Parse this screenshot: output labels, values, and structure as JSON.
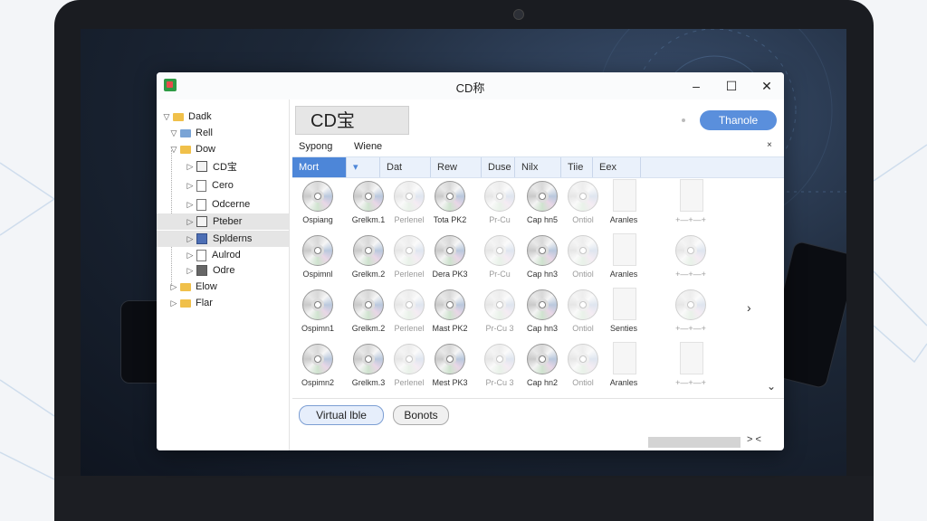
{
  "window": {
    "title": "CD称"
  },
  "controls": {
    "minimize": "–",
    "maximize": "☐",
    "close": "✕"
  },
  "sidebar": {
    "items": [
      {
        "toggle": "▽",
        "label": "Dadk"
      },
      {
        "toggle": "▽",
        "label": "Rell"
      },
      {
        "toggle": "▽",
        "label": "Dow"
      },
      {
        "toggle": "▷",
        "label": "CD宝"
      },
      {
        "toggle": "▷",
        "label": "Cero"
      },
      {
        "toggle": "▷",
        "label": "Odcerne"
      },
      {
        "toggle": "▷",
        "label": "Pteber"
      },
      {
        "toggle": "▷",
        "label": "Splderns"
      },
      {
        "toggle": "▷",
        "label": "Aulrod"
      },
      {
        "toggle": "▷",
        "label": "Odre"
      },
      {
        "toggle": "▷",
        "label": "Elow"
      },
      {
        "toggle": "▷",
        "label": "Flar"
      }
    ]
  },
  "header": {
    "title_box": "CD宝",
    "primary_button": "Thanole"
  },
  "tabs": [
    "Sypong",
    "Wiene"
  ],
  "tabs_close": "×",
  "toolbar": {
    "items": [
      "Mort",
      "▾",
      "Dat",
      "Rew",
      "Duse",
      "Nilx",
      "Tiie",
      "Eex"
    ]
  },
  "grid": {
    "rows": [
      [
        "Ospiang",
        "Grelkm.1",
        "Perlenel",
        "Tota PK2",
        "Pr-Cu",
        "Cap hn5",
        "Ontiol",
        "Aranles",
        "+—+—+"
      ],
      [
        "Ospimnl",
        "Grelkm.2",
        "Perlenel",
        "Dera PK3",
        "Pr-Cu",
        "Cap hn3",
        "Ontiol",
        "Aranles",
        "+—+—+"
      ],
      [
        "Ospimn1",
        "Grelkm.2",
        "Perlenel",
        "Mast PK2",
        "Pr-Cu 3",
        "Cap hn3",
        "Ontiol",
        "Senties",
        "+—+—+"
      ],
      [
        "Ospimn2",
        "Grelkm.3",
        "Perlenel",
        "Mest PK3",
        "Pr-Cu 3",
        "Cap hn2",
        "Ontiol",
        "Aranles",
        "+—+—+"
      ]
    ]
  },
  "footer": {
    "virtual_button": "Virtual lble",
    "secondary_button": "Bonots",
    "scroll_arrows": "> <"
  },
  "colors": {
    "accent": "#4d86d8",
    "primary_button": "#5a8fdc",
    "toolbar_bg": "#eaf1fb"
  },
  "icons": [
    "app-icon",
    "folder-icon",
    "disc-icon",
    "document-icon",
    "chevron-right-icon",
    "chevron-down-icon"
  ]
}
